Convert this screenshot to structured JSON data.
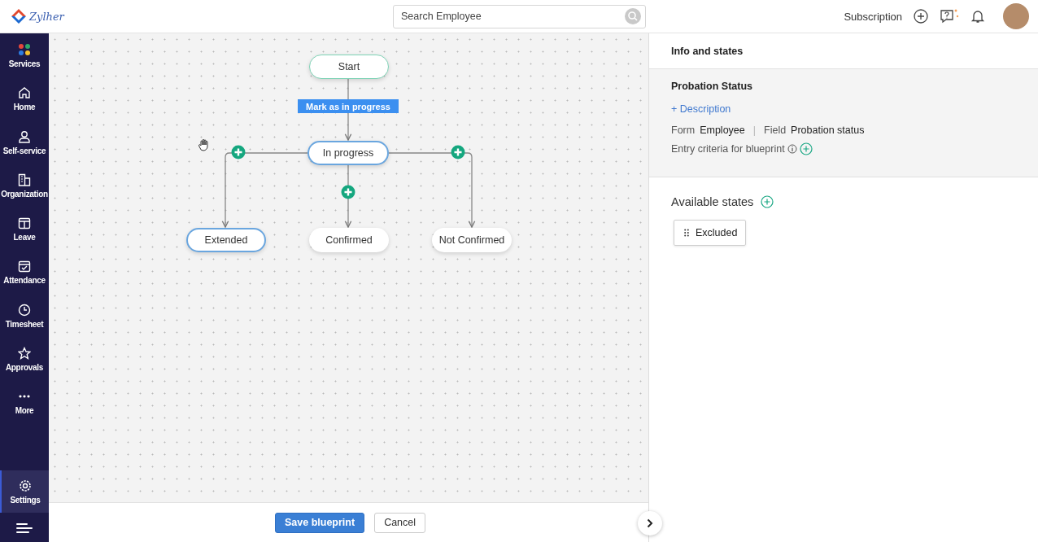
{
  "header": {
    "brand": "Zylher",
    "search": {
      "placeholder": "Search Employee"
    },
    "subscription": "Subscription"
  },
  "sidebar": {
    "items": [
      {
        "label": "Services",
        "selected": false
      },
      {
        "label": "Home",
        "selected": false
      },
      {
        "label": "Self-service",
        "selected": false
      },
      {
        "label": "Organization",
        "selected": false
      },
      {
        "label": "Leave",
        "selected": false
      },
      {
        "label": "Attendance",
        "selected": false
      },
      {
        "label": "Timesheet",
        "selected": false
      },
      {
        "label": "Approvals",
        "selected": false
      },
      {
        "label": "More",
        "selected": false
      }
    ],
    "settings": {
      "label": "Settings",
      "selected": true
    }
  },
  "blueprint": {
    "nodes": [
      {
        "label": "Start",
        "kind": "start",
        "selected": false
      },
      {
        "label": "In progress",
        "kind": "state",
        "selected": true
      },
      {
        "label": "Extended",
        "kind": "state",
        "selected": true
      },
      {
        "label": "Confirmed",
        "kind": "state",
        "selected": false
      },
      {
        "label": "Not Confirmed",
        "kind": "state",
        "selected": false
      }
    ],
    "transition_label": "Mark as in progress"
  },
  "actions": {
    "save": "Save blueprint",
    "cancel": "Cancel"
  },
  "panel": {
    "title": "Info and states",
    "name": "Probation Status",
    "add_description": "+ Description",
    "form_label": "Form",
    "form_value": "Employee",
    "separator": "|",
    "field_label": "Field",
    "field_value": "Probation status",
    "entry_criteria": "Entry criteria for blueprint",
    "available_states_title": "Available states",
    "available_states": [
      "Excluded"
    ]
  }
}
